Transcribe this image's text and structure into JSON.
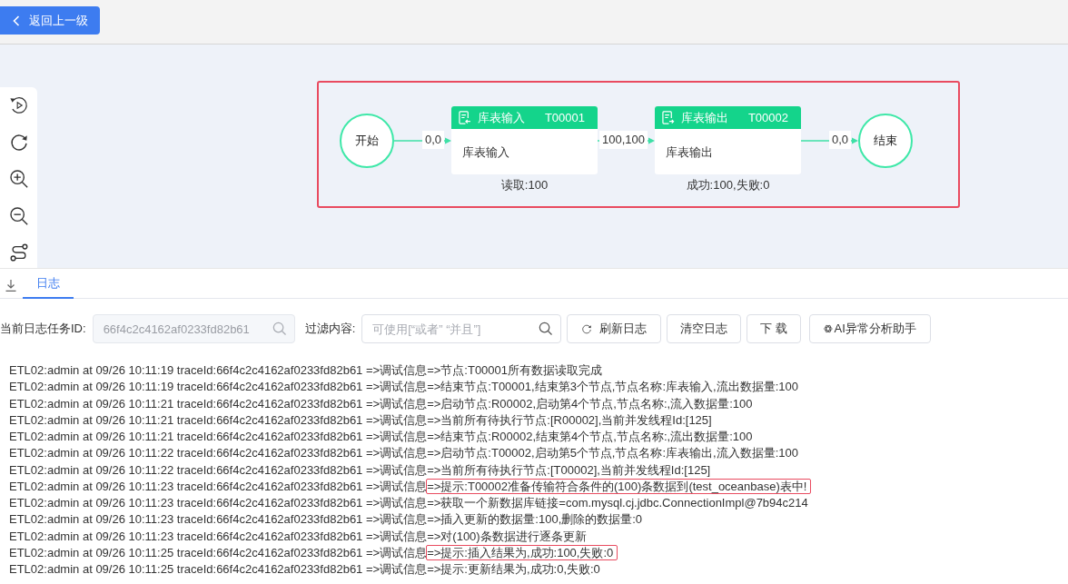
{
  "back_button": {
    "label": "返回上一级"
  },
  "flow": {
    "highlighted": true,
    "items": [
      {
        "kind": "terminal",
        "label": "开始"
      },
      {
        "kind": "edge",
        "label": "0,0"
      },
      {
        "kind": "input",
        "title": "库表输入",
        "code": "T00001",
        "body": "库表输入",
        "stats": "读取:100"
      },
      {
        "kind": "edge",
        "label": "100,100"
      },
      {
        "kind": "output",
        "title": "库表输出",
        "code": "T00002",
        "body": "库表输出",
        "stats": "成功:100,失败:0"
      },
      {
        "kind": "edge",
        "label": "0,0"
      },
      {
        "kind": "terminal",
        "label": "结束"
      }
    ]
  },
  "log_panel": {
    "tabs": [
      {
        "label": "日志",
        "selected": true
      }
    ],
    "task_id": {
      "label": "当前日志任务ID:",
      "value": "66f4c2c4162af0233fd82b61",
      "disabled": true
    },
    "filter": {
      "label": "过滤内容:",
      "placeholder": "可使用[“或者” “并且”]"
    },
    "buttons": [
      {
        "label": "刷新日志",
        "kind": "refresh"
      },
      {
        "label": "清空日志",
        "kind": "plain"
      },
      {
        "label": "下 载",
        "kind": "plain"
      },
      {
        "label": "AI异常分析助手",
        "kind": "ai"
      }
    ],
    "lines": [
      {
        "head": "ETL02:admin at 09/26 10:11:19 traceId:66f4c2c4162af0233fd82b61 =>调试信息",
        "detail": "=>节点:T00001所有数据读取完成",
        "highlighted": false
      },
      {
        "head": "ETL02:admin at 09/26 10:11:19 traceId:66f4c2c4162af0233fd82b61 =>调试信息",
        "detail": "=>结束节点:T00001,结束第3个节点,节点名称:库表输入,流出数据量:100",
        "highlighted": false
      },
      {
        "head": "ETL02:admin at 09/26 10:11:21 traceId:66f4c2c4162af0233fd82b61 =>调试信息",
        "detail": "=>启动节点:R00002,启动第4个节点,节点名称:,流入数据量:100",
        "highlighted": false
      },
      {
        "head": "ETL02:admin at 09/26 10:11:21 traceId:66f4c2c4162af0233fd82b61 =>调试信息",
        "detail": "=>当前所有待执行节点:[R00002],当前并发线程Id:[125]",
        "highlighted": false
      },
      {
        "head": "ETL02:admin at 09/26 10:11:21 traceId:66f4c2c4162af0233fd82b61 =>调试信息",
        "detail": "=>结束节点:R00002,结束第4个节点,节点名称:,流出数据量:100",
        "highlighted": false
      },
      {
        "head": "ETL02:admin at 09/26 10:11:22 traceId:66f4c2c4162af0233fd82b61 =>调试信息",
        "detail": "=>启动节点:T00002,启动第5个节点,节点名称:库表输出,流入数据量:100",
        "highlighted": false
      },
      {
        "head": "ETL02:admin at 09/26 10:11:22 traceId:66f4c2c4162af0233fd82b61 =>调试信息",
        "detail": "=>当前所有待执行节点:[T00002],当前并发线程Id:[125]",
        "highlighted": false
      },
      {
        "head": "ETL02:admin at 09/26 10:11:23 traceId:66f4c2c4162af0233fd82b61 =>调试信息",
        "detail": "=>提示:T00002准备传输符合条件的(100)条数据到(test_oceanbase)表中!",
        "highlighted": true
      },
      {
        "head": "ETL02:admin at 09/26 10:11:23 traceId:66f4c2c4162af0233fd82b61 =>调试信息",
        "detail": "=>获取一个新数据库链接=com.mysql.cj.jdbc.ConnectionImpl@7b94c214",
        "highlighted": false
      },
      {
        "head": "ETL02:admin at 09/26 10:11:23 traceId:66f4c2c4162af0233fd82b61 =>调试信息",
        "detail": "=>插入更新的数据量:100,删除的数据量:0",
        "highlighted": false
      },
      {
        "head": "ETL02:admin at 09/26 10:11:23 traceId:66f4c2c4162af0233fd82b61 =>调试信息",
        "detail": "=>对(100)条数据进行逐条更新",
        "highlighted": false
      },
      {
        "head": "ETL02:admin at 09/26 10:11:25 traceId:66f4c2c4162af0233fd82b61 =>调试信息",
        "detail": "=>提示:插入结果为,成功:100,失败:0",
        "highlighted": true
      },
      {
        "head": "ETL02:admin at 09/26 10:11:25 traceId:66f4c2c4162af0233fd82b61 =>调试信息",
        "detail": "=>提示:更新结果为,成功:0,失败:0",
        "highlighted": false
      }
    ]
  }
}
